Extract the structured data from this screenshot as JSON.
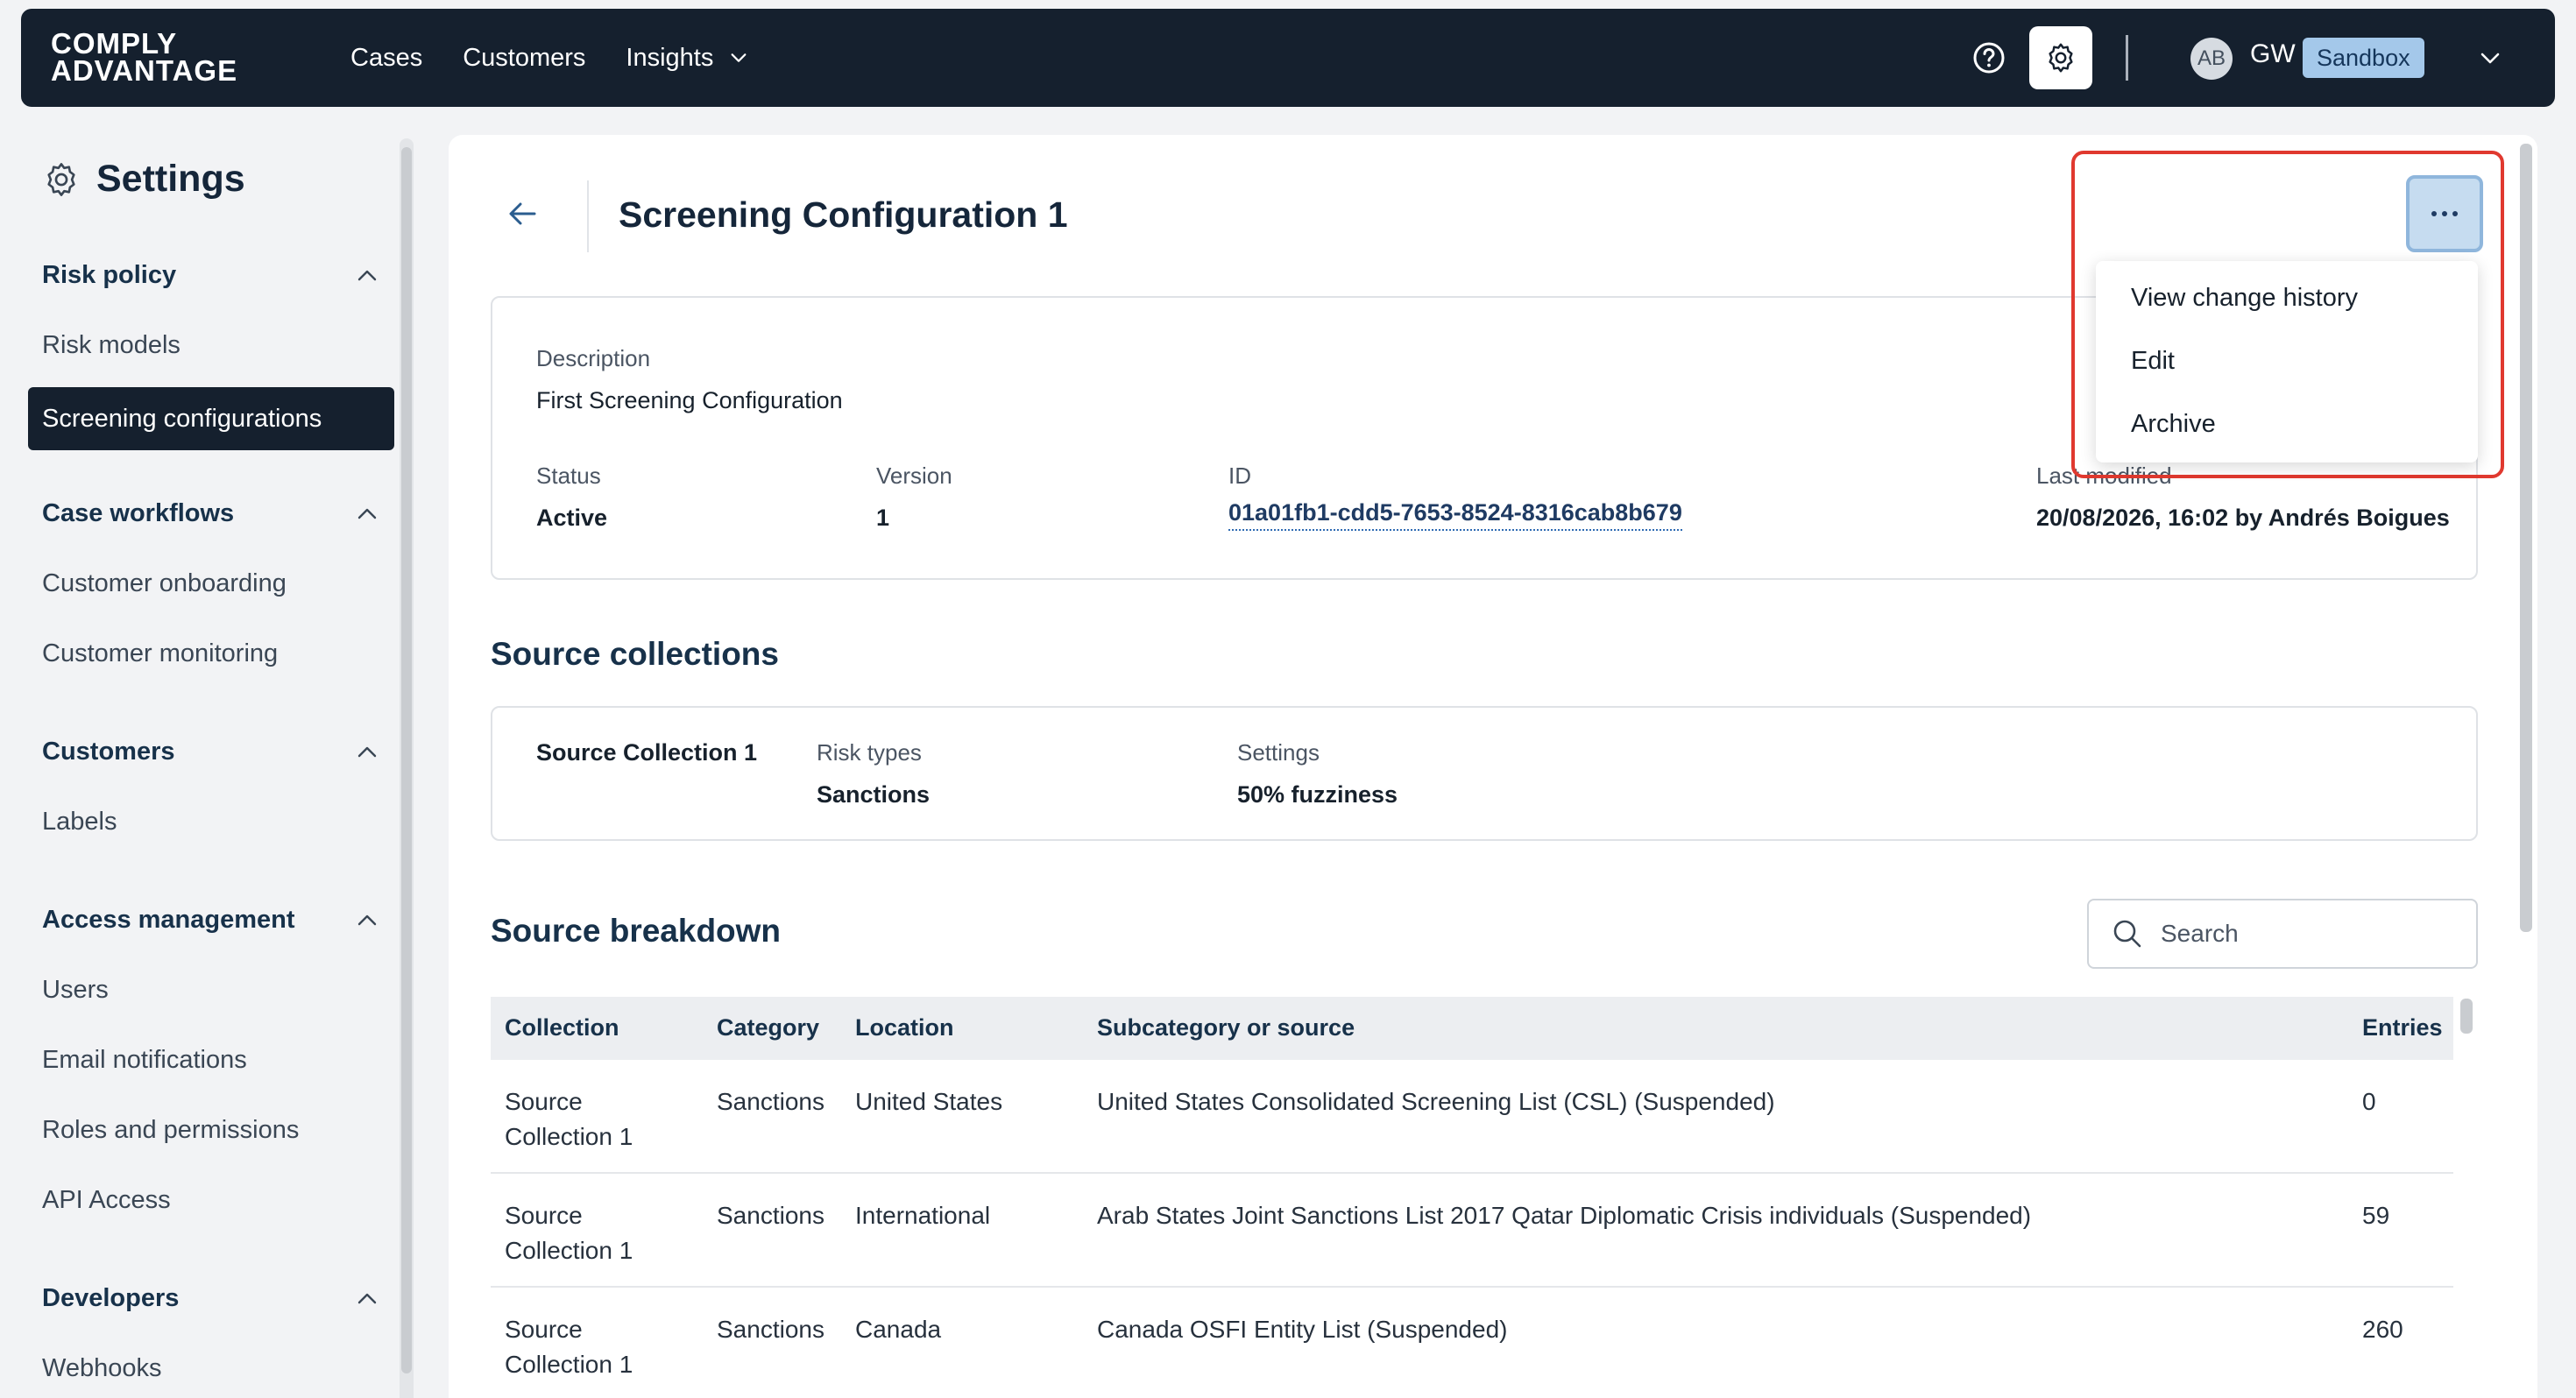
{
  "brand": {
    "line1": "COMPLY",
    "line2": "ADVANTAGE"
  },
  "topnav": {
    "links": [
      "Cases",
      "Customers",
      "Insights"
    ],
    "avatar": "AB",
    "user": "GW",
    "environment": "Sandbox"
  },
  "sidebar": {
    "title": "Settings",
    "sections": [
      {
        "label": "Risk policy",
        "items": [
          "Risk models",
          "Screening configurations"
        ]
      },
      {
        "label": "Case workflows",
        "items": [
          "Customer onboarding",
          "Customer monitoring"
        ]
      },
      {
        "label": "Customers",
        "items": [
          "Labels"
        ]
      },
      {
        "label": "Access management",
        "items": [
          "Users",
          "Email notifications",
          "Roles and permissions",
          "API Access"
        ]
      },
      {
        "label": "Developers",
        "items": [
          "Webhooks"
        ]
      }
    ],
    "active_item": "Screening configurations"
  },
  "page": {
    "title": "Screening Configuration 1",
    "details": {
      "description_label": "Description",
      "description": "First Screening Configuration",
      "status_label": "Status",
      "status": "Active",
      "version_label": "Version",
      "version": "1",
      "id_label": "ID",
      "id": "01a01fb1-cdd5-7653-8524-8316cab8b679",
      "modified_label": "Last modified",
      "modified": "20/08/2026, 16:02 by Andrés Boigues"
    },
    "menu": [
      "View change history",
      "Edit",
      "Archive"
    ]
  },
  "source_collections": {
    "heading": "Source collections",
    "name": "Source Collection 1",
    "risk_types_label": "Risk types",
    "risk_types": "Sanctions",
    "settings_label": "Settings",
    "settings": "50% fuzziness"
  },
  "source_breakdown": {
    "heading": "Source breakdown",
    "search_placeholder": "Search",
    "columns": [
      "Collection",
      "Category",
      "Location",
      "Subcategory or source",
      "Entries"
    ],
    "rows": [
      {
        "collection": "Source Collection 1",
        "category": "Sanctions",
        "location": "United States",
        "source": "United States Consolidated Screening List (CSL) (Suspended)",
        "entries": "0"
      },
      {
        "collection": "Source Collection 1",
        "category": "Sanctions",
        "location": "International",
        "source": "Arab States Joint Sanctions List 2017 Qatar Diplomatic Crisis individuals (Suspended)",
        "entries": "59"
      },
      {
        "collection": "Source Collection 1",
        "category": "Sanctions",
        "location": "Canada",
        "source": "Canada OSFI Entity List (Suspended)",
        "entries": "260"
      }
    ]
  },
  "colors": {
    "nav_bg": "#15202e",
    "accent_highlight": "#e0392f",
    "sandbox_badge": "#a4c8ea"
  }
}
